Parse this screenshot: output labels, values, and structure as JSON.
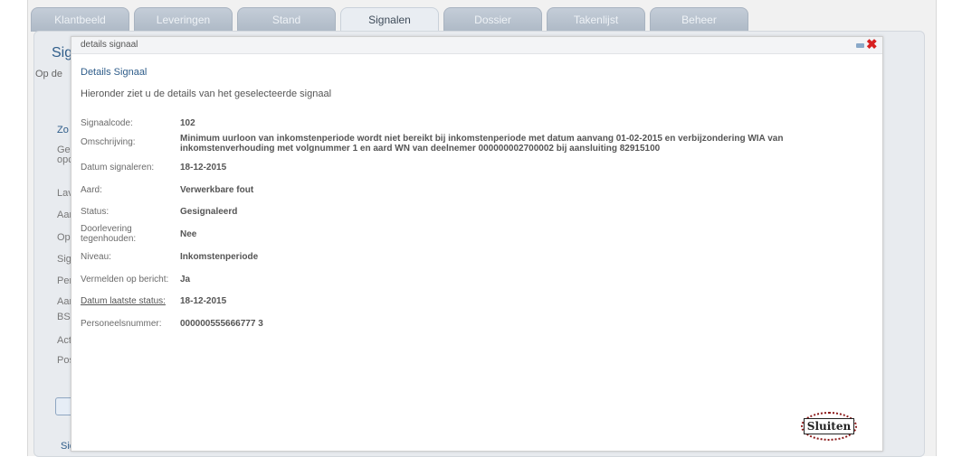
{
  "tabs": [
    {
      "label": "Klantbeeld"
    },
    {
      "label": "Leveringen"
    },
    {
      "label": "Stand"
    },
    {
      "label": "Signalen",
      "active": true
    },
    {
      "label": "Dossier"
    },
    {
      "label": "Takenlijst"
    },
    {
      "label": "Beheer"
    }
  ],
  "background": {
    "title_fragment": "Sign",
    "sub_fragment": "Op de",
    "fragments": [
      "Zo",
      "Ge",
      "opc",
      "Lav",
      "Aar",
      "Op",
      "Sig",
      "Per",
      "Aar",
      "BSI",
      "Act",
      "Pos",
      "Sic"
    ]
  },
  "dialog": {
    "header_title": "details signaal",
    "section_title": "Details Signaal",
    "intro": "Hieronder ziet u de details van het geselecteerde signaal",
    "fields": [
      {
        "label": "Signaalcode:",
        "value": "102"
      },
      {
        "label": "Omschrijving:",
        "value": "Minimum uurloon van inkomstenperiode wordt niet bereikt bij inkomstenperiode met datum aanvang 01-02-2015 en verbijzondering WIA van inkomstenverhouding met volgnummer 1 en aard WN van deelnemer 000000002700002 bij aansluiting 82915100"
      },
      {
        "label": "Datum signaleren:",
        "value": "18-12-2015"
      },
      {
        "label": "Aard:",
        "value": "Verwerkbare fout"
      },
      {
        "label": "Status:",
        "value": "Gesignaleerd"
      },
      {
        "label": "Doorlevering tegenhouden:",
        "value": "Nee"
      },
      {
        "label": "Niveau:",
        "value": "Inkomstenperiode"
      },
      {
        "label": "Vermelden op bericht:",
        "value": "Ja"
      },
      {
        "label": "Datum laatste status:",
        "value": "18-12-2015"
      },
      {
        "label": "Personeelsnummer:",
        "value": "000000555666777 3"
      }
    ],
    "close_button": "Sluiten"
  },
  "colors": {
    "accent": "#2f5d8a",
    "close": "#d82020",
    "highlight": "#8b1a1a"
  }
}
